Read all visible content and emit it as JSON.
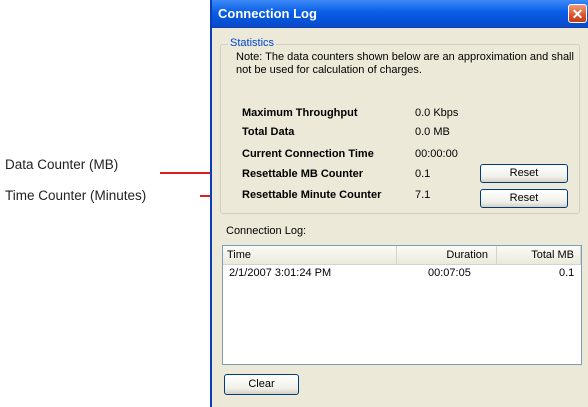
{
  "callouts": {
    "data_counter": "Data Counter (MB)",
    "time_counter": "Time Counter (Minutes)",
    "line_color": "#d8201c"
  },
  "window": {
    "title": "Connection Log",
    "close_icon": "close-icon"
  },
  "statistics": {
    "caption": "Statistics",
    "note": "Note: The data counters shown below are an approximation and shall not be used for calculation of charges.",
    "rows": [
      {
        "label": "Maximum Throughput",
        "value": "0.0 Kbps"
      },
      {
        "label": "Total Data",
        "value": "0.0 MB"
      },
      {
        "label": "Current Connection Time",
        "value": "00:00:00"
      },
      {
        "label": "Resettable MB Counter",
        "value": "0.1"
      },
      {
        "label": "Resettable Minute Counter",
        "value": "7.1"
      }
    ],
    "reset_mb_label": "Reset",
    "reset_minute_label": "Reset"
  },
  "log": {
    "caption": "Connection Log:",
    "columns": [
      "Time",
      "Duration",
      "Total MB"
    ],
    "rows": [
      {
        "time": "2/1/2007 3:01:24 PM",
        "duration": "00:07:05",
        "total_mb": "0.1"
      }
    ]
  },
  "clear_label": "Clear",
  "colors": {
    "titlebar": "#0a5ee6",
    "dialog_bg": "#ece9d8",
    "group_caption": "#0046d5"
  }
}
